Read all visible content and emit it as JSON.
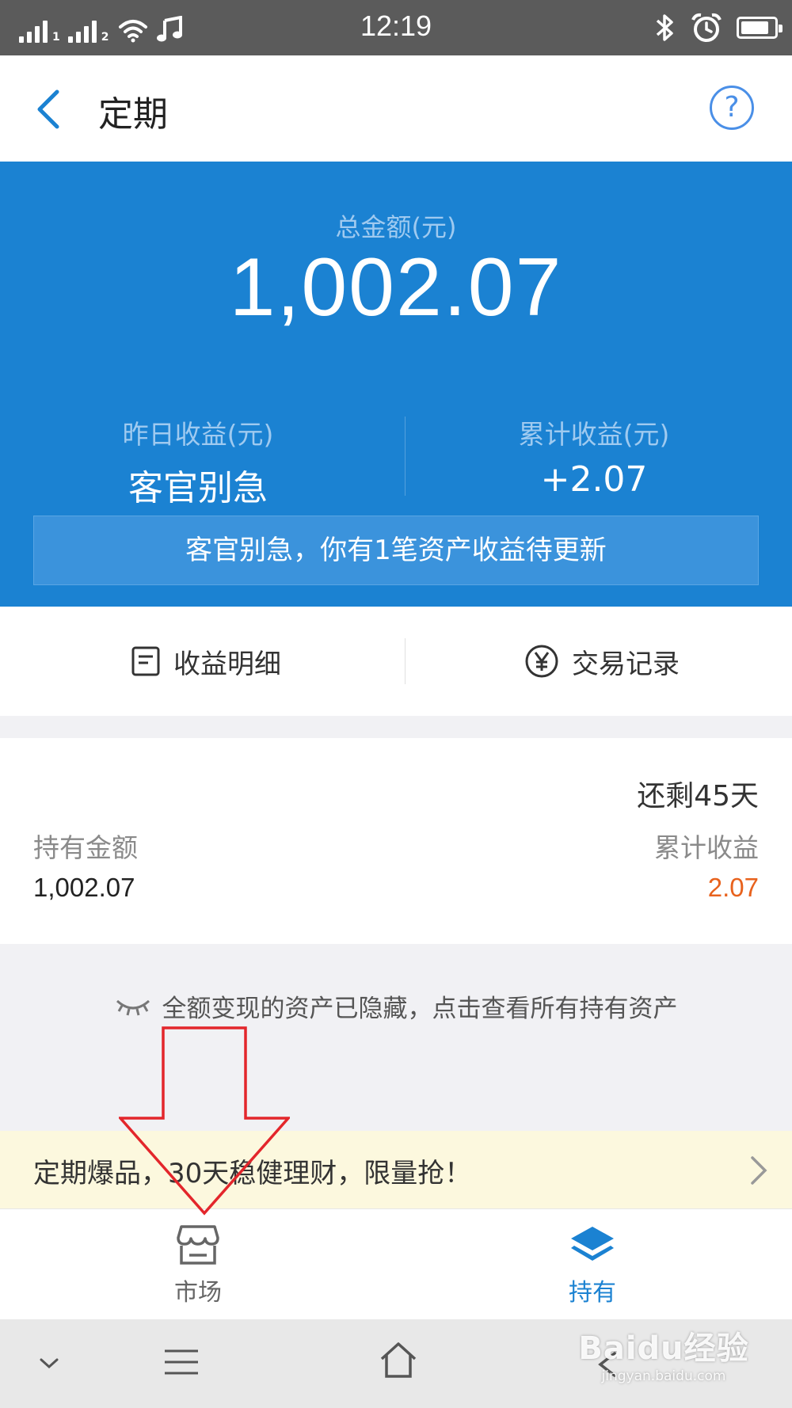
{
  "status_bar": {
    "time": "12:19",
    "sim1": "1",
    "sim2": "2"
  },
  "header": {
    "title": "定期"
  },
  "summary": {
    "total_label": "总金额(元)",
    "total_amount": "1,002.07",
    "yesterday_label": "昨日收益(元)",
    "yesterday_value": "客官别急",
    "cumulative_label": "累计收益(元)",
    "cumulative_value": "+2.07",
    "notice": "客官别急，你有1笔资产收益待更新"
  },
  "actions": {
    "income_detail": "收益明细",
    "transaction_record": "交易记录"
  },
  "holding_card": {
    "remaining": "还剩45天",
    "holding_label": "持有金额",
    "holding_value": "1,002.07",
    "earnings_label": "累计收益",
    "earnings_value": "2.07"
  },
  "hidden_hint": "全额变现的资产已隐藏，点击查看所有持有资产",
  "promo": {
    "text": "定期爆品，30天稳健理财，限量抢！"
  },
  "tabs": [
    {
      "label": "市场",
      "icon": "store-icon"
    },
    {
      "label": "持有",
      "icon": "layers-icon"
    }
  ],
  "watermark": {
    "main": "Baidu经验",
    "sub": "jingyan.baidu.com"
  },
  "colors": {
    "brand_blue": "#1b82d2",
    "earnings_orange": "#e8621d",
    "annotation_red": "#e3262b",
    "promo_bg": "#fcf8de"
  }
}
